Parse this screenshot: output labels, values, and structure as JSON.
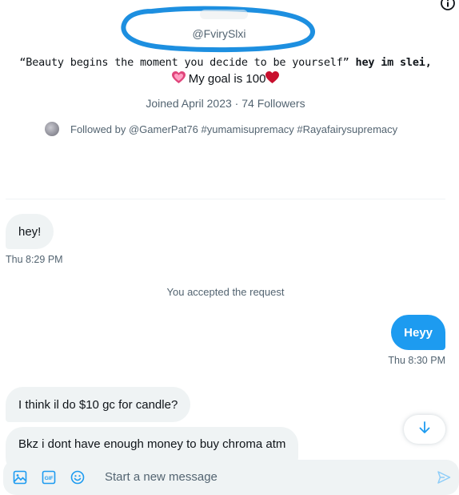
{
  "profile": {
    "handle": "@FvirySlxi",
    "bio_line1": "“Beauty begins the moment you decide to be yourself” ",
    "bio_line1_bold": "hey im slei,",
    "bio_line2": " My goal is 100",
    "joined": "Joined April 2023 · 74 Followers",
    "followed_by": "Followed by @GamerPat76 #yumamisupremacy #Rayafairysupremacy"
  },
  "messages": {
    "m1": "hey!",
    "t1": "Thu 8:29 PM",
    "notice": "You accepted the request",
    "m2": "Heyy",
    "t2": "Thu 8:30 PM",
    "m3": "I think il do $10 gc for candle?",
    "m4": "Bkz i dont have enough money to buy chroma atm"
  },
  "composer": {
    "placeholder": "Start a new message"
  },
  "colors": {
    "accent": "#1d9bf0",
    "bubble_in": "#eff3f4",
    "muted_text": "#536471",
    "scribble": "#1d8fe0"
  },
  "icons": [
    "info-icon",
    "image-icon",
    "gif-icon",
    "emoji-icon",
    "send-icon",
    "arrow-down-icon",
    "pink-heart-icon",
    "red-heart-icon"
  ]
}
